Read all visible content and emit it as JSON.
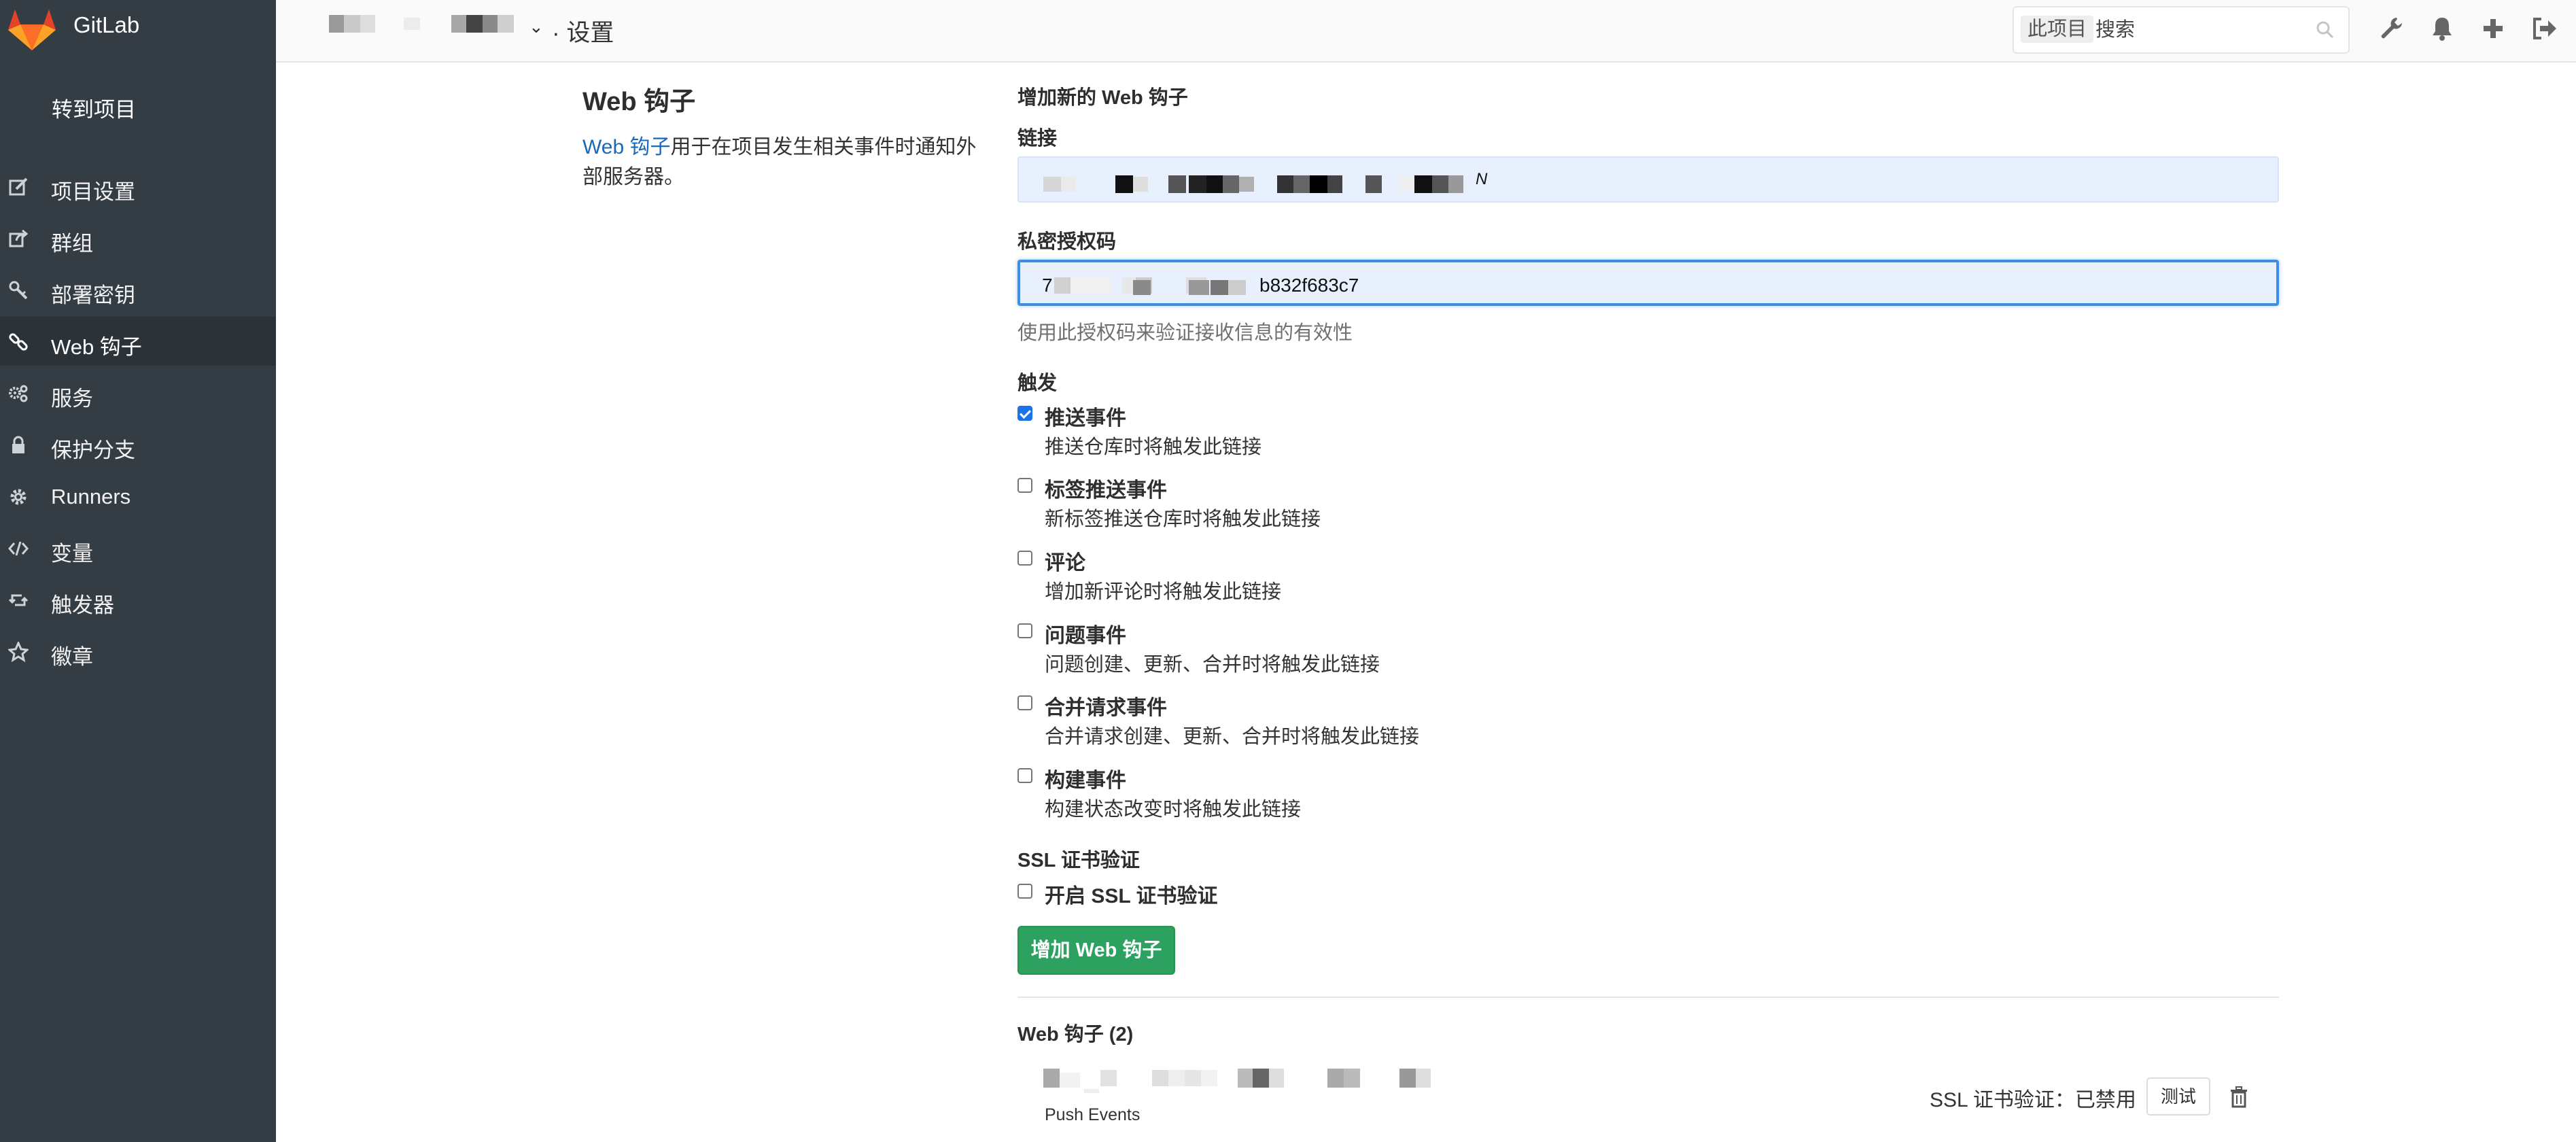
{
  "sidebar": {
    "brand": "GitLab",
    "back_link": "转到项目",
    "items": [
      {
        "label": "项目设置",
        "icon": "edit-icon"
      },
      {
        "label": "群组",
        "icon": "share-icon"
      },
      {
        "label": "部署密钥",
        "icon": "key-icon"
      },
      {
        "label": "Web 钩子",
        "icon": "link-icon",
        "active": true
      },
      {
        "label": "服务",
        "icon": "cogs-icon"
      },
      {
        "label": "保护分支",
        "icon": "lock-icon"
      },
      {
        "label": "Runners",
        "icon": "gear-icon"
      },
      {
        "label": "变量",
        "icon": "code-icon"
      },
      {
        "label": "触发器",
        "icon": "retweet-icon"
      },
      {
        "label": "徽章",
        "icon": "star-icon"
      }
    ]
  },
  "header": {
    "breadcrumb_separator": "·",
    "breadcrumb_current": "设置",
    "search_scope": "此项目",
    "search_placeholder": "搜索",
    "icons": [
      "wrench-icon",
      "bell-icon",
      "plus-icon",
      "sign-out-icon"
    ]
  },
  "section": {
    "title": "Web 钩子",
    "desc_link": "Web 钩子",
    "desc_rest": "用于在项目发生相关事件时通知外部服务器。"
  },
  "form": {
    "heading": "增加新的 Web 钩子",
    "url_label": "链接",
    "url_value_suffix": "N",
    "token_label": "私密授权码",
    "token_value_prefix": "7",
    "token_value_suffix": "b832f683c7",
    "token_help": "使用此授权码来验证接收信息的有效性",
    "trigger_label": "触发",
    "events": [
      {
        "title": "推送事件",
        "desc": "推送仓库时将触发此链接",
        "checked": true
      },
      {
        "title": "标签推送事件",
        "desc": "新标签推送仓库时将触发此链接",
        "checked": false
      },
      {
        "title": "评论",
        "desc": "增加新评论时将触发此链接",
        "checked": false
      },
      {
        "title": "问题事件",
        "desc": "问题创建、更新、合并时将触发此链接",
        "checked": false
      },
      {
        "title": "合并请求事件",
        "desc": "合并请求创建、更新、合并时将触发此链接",
        "checked": false
      },
      {
        "title": "构建事件",
        "desc": "构建状态改变时将触发此链接",
        "checked": false
      }
    ],
    "ssl_label": "SSL 证书验证",
    "ssl_option": "开启 SSL 证书验证",
    "ssl_checked": false,
    "submit_label": "增加 Web 钩子"
  },
  "hooks": {
    "title": "Web 钩子 (2)",
    "items": [
      {
        "event": "Push Events",
        "ssl_status": "SSL 证书验证：已禁用",
        "test_label": "测试"
      }
    ]
  }
}
